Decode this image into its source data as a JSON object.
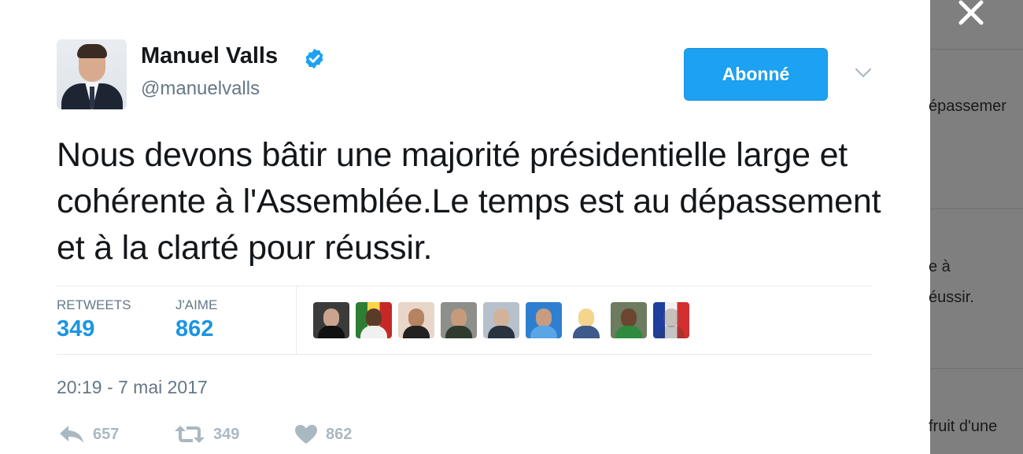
{
  "user": {
    "display_name": "Manuel Valls",
    "handle": "@manuelvalls",
    "verified": true
  },
  "follow_button": {
    "label": "Abonné"
  },
  "tweet": {
    "text": "Nous devons bâtir une majorité présidentielle large et cohérente à l'Assemblée.Le temps est au dépassement et à la clarté pour réussir.",
    "timestamp": "20:19 - 7 mai 2017"
  },
  "stats": {
    "retweets_label": "RETWEETS",
    "retweets_value": "349",
    "likes_label": "J'AIME",
    "likes_value": "862"
  },
  "actions": {
    "reply_count": "657",
    "retweet_count": "349",
    "like_count": "862"
  },
  "background_thread": {
    "fragments": [
      "épassemer",
      "e à",
      "éussir.",
      "fruit d'une"
    ]
  },
  "colors": {
    "accent": "#1da1f2",
    "stat_blue": "#1b95e0",
    "text_primary": "#14171a",
    "text_secondary": "#657786",
    "overlay": "#7f7f7f"
  }
}
